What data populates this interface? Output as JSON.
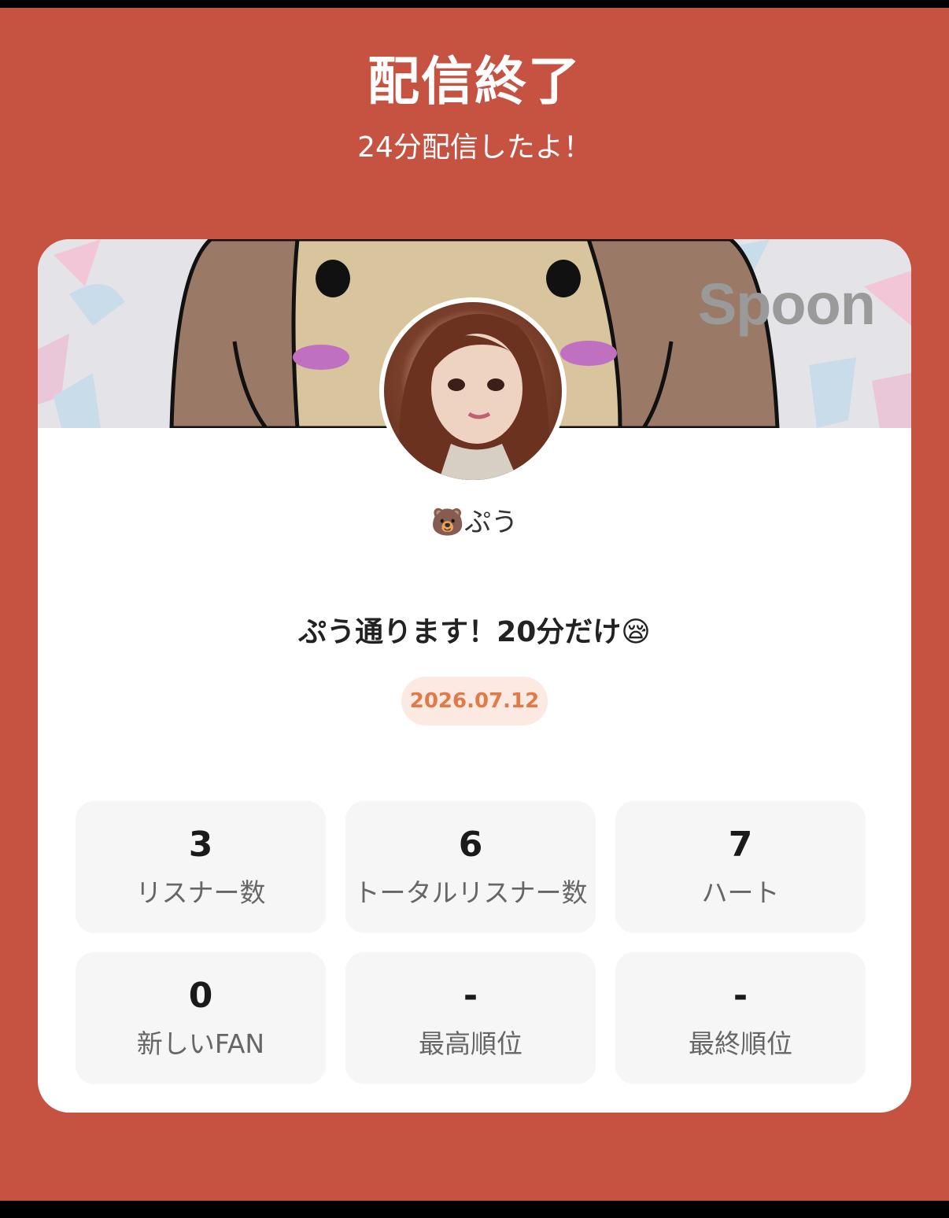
{
  "header": {
    "title": "配信終了",
    "subtitle": "24分配信したよ！"
  },
  "card": {
    "brand_logo_text": "Spoon",
    "username": "🐻ぷう",
    "live_title": "ぷう通ります！20分だけ😪",
    "date": "2026.07.12",
    "stats": [
      {
        "value": "3",
        "label": "リスナー数"
      },
      {
        "value": "6",
        "label": "トータルリスナー数"
      },
      {
        "value": "7",
        "label": "ハート"
      },
      {
        "value": "0",
        "label": "新しいFAN"
      },
      {
        "value": "-",
        "label": "最高順位"
      },
      {
        "value": "-",
        "label": "最終順位"
      }
    ]
  },
  "colors": {
    "background": "#c65242",
    "date_text": "#e07a46",
    "date_pill": "#fbe9e2"
  }
}
